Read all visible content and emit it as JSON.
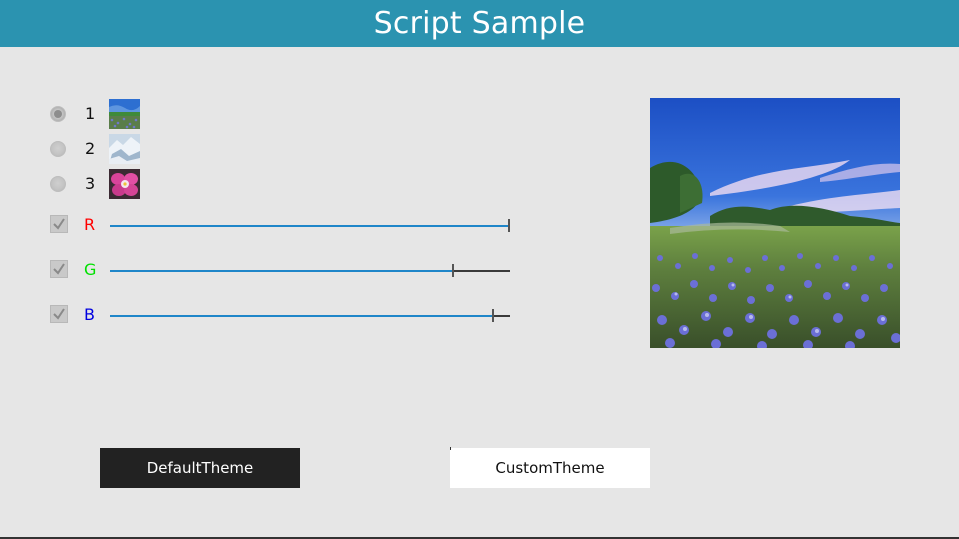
{
  "header": {
    "title": "Script Sample",
    "color": "#2b93b0"
  },
  "images": {
    "selected": 1,
    "options": [
      {
        "label": "1",
        "thumbnail": "meadow-thumbnail"
      },
      {
        "label": "2",
        "thumbnail": "snow-mountain-thumbnail"
      },
      {
        "label": "3",
        "thumbnail": "orchid-thumbnail"
      }
    ]
  },
  "channels": [
    {
      "label": "R",
      "color": "#ff0000",
      "checked": true,
      "value": 1.0
    },
    {
      "label": "G",
      "color": "#00e000",
      "checked": true,
      "value": 0.86
    },
    {
      "label": "B",
      "color": "#0000e0",
      "checked": true,
      "value": 0.96
    }
  ],
  "buttons": {
    "default_theme": "DefaultTheme",
    "custom_theme": "CustomTheme"
  },
  "preview": {
    "subject": "bluebonnet-meadow-landscape"
  }
}
